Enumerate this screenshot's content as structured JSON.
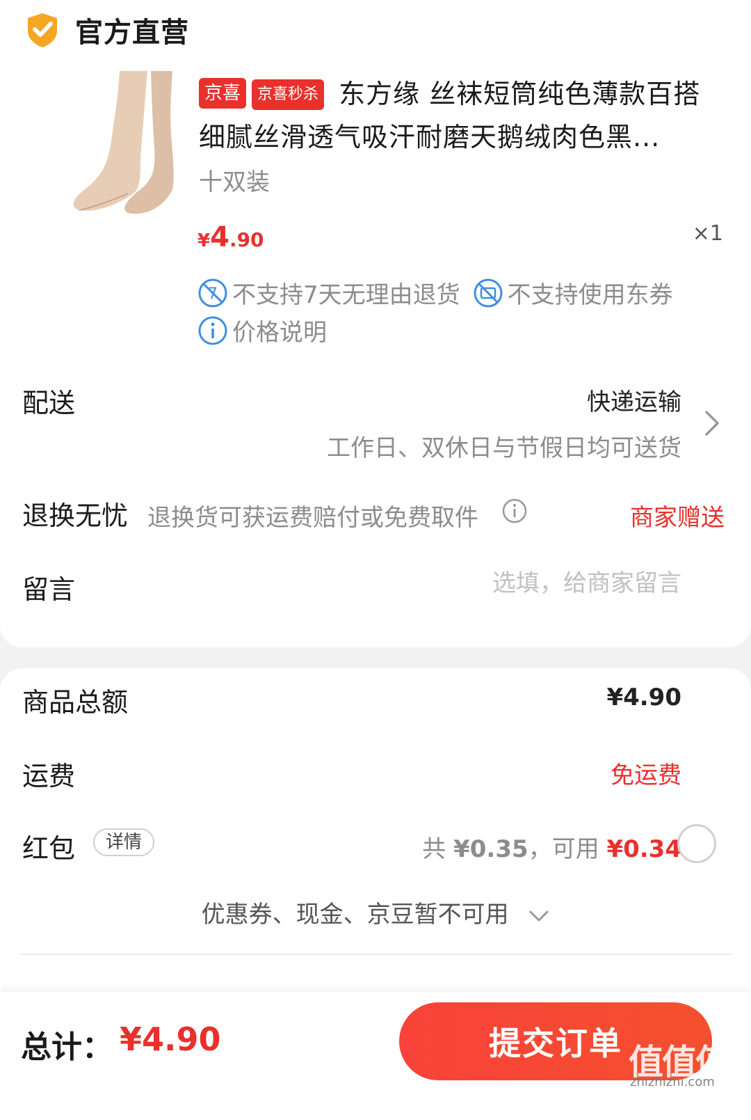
{
  "shop": {
    "name": "官方直营"
  },
  "product": {
    "tags": [
      "京喜",
      "京喜秒杀"
    ],
    "title": "东方缘 丝袜短筒纯色薄款百搭细腻丝滑透气吸汗耐磨天鹅绒肉色黑...",
    "spec": "十双装",
    "price_currency": "¥",
    "price_int": "4",
    "price_dec": ".90",
    "quantity": "×1"
  },
  "services": {
    "no_return": "不支持7天无理由退货",
    "no_coupon": "不支持使用东券",
    "price_note": "价格说明"
  },
  "delivery": {
    "label": "配送",
    "method": "快递运输",
    "schedule": "工作日、双休日与节假日均可送货"
  },
  "returns": {
    "label": "退换无忧",
    "desc": "退换货可获运费赔付或免费取件",
    "gift": "商家赠送"
  },
  "message": {
    "label": "留言",
    "placeholder": "选填，给商家留言"
  },
  "summary": {
    "goods_total_label": "商品总额",
    "goods_total_value": "¥4.90",
    "shipping_label": "运费",
    "shipping_value": "免运费",
    "redpacket_label": "红包",
    "redpacket_detail": "详情",
    "redpacket_total_prefix": "共 ",
    "redpacket_total": "¥0.35",
    "redpacket_avail_prefix": "，可用 ",
    "redpacket_available": "¥0.34",
    "coupon_note": "优惠券、现金、京豆暂不可用"
  },
  "footer": {
    "total_label": "总计：",
    "total_value": "¥4.90",
    "submit_label": "提交订单",
    "watermark": "值值值",
    "watermark_site": "zhizhizhi.com"
  },
  "colors": {
    "accent": "#e9302d",
    "shield": "#f5a623",
    "service_blue": "#3d8fe0"
  },
  "icons": [
    "shield-check-icon",
    "no-return-icon",
    "coupon-disabled-icon",
    "info-icon",
    "chevron-right-icon",
    "chevron-down-icon"
  ]
}
